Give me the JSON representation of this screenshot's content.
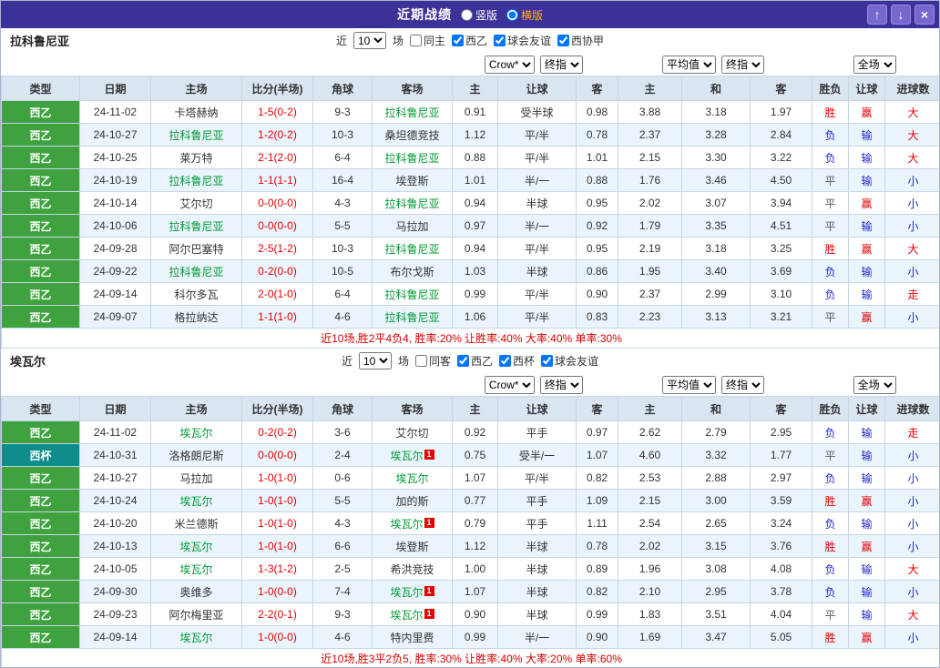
{
  "titlebar": {
    "title": "近期战绩",
    "layout_options": [
      {
        "label": "竖版",
        "selected": false
      },
      {
        "label": "横版",
        "selected": true
      }
    ],
    "buttons": {
      "up": "↑",
      "down": "↓",
      "close": "×"
    }
  },
  "colors": {
    "titlebar_bg": "#3c3099",
    "league": {
      "西乙": "#3fa23f",
      "西杯": "#0f8c8c"
    },
    "self_team": "#009933",
    "win_red": "#e60000",
    "lose_blue": "#2026d2"
  },
  "col_headers": [
    "类型",
    "日期",
    "主场",
    "比分(半场)",
    "角球",
    "客场",
    "主",
    "让球",
    "客",
    "主",
    "和",
    "客",
    "胜负",
    "让球",
    "进球数"
  ],
  "tables": [
    {
      "team": "拉科鲁尼亚",
      "near_prefix": "近",
      "near_count": "10",
      "near_suffix": "场",
      "filters": [
        {
          "label": "同主",
          "checked": false
        },
        {
          "label": "西乙",
          "checked": true
        },
        {
          "label": "球会友谊",
          "checked": true
        },
        {
          "label": "西协甲",
          "checked": true
        }
      ],
      "selects": {
        "bookmaker": "Crow*",
        "bookmaker_stage": "终指",
        "average": "平均值",
        "average_stage": "终指",
        "scope": "全场"
      },
      "rows": [
        {
          "league": "西乙",
          "date": "24-11-02",
          "home": "卡塔赫纳",
          "home_self": false,
          "score": "1-5(0-2)",
          "corner": "9-3",
          "away": "拉科鲁尼亚",
          "away_self": true,
          "odds": [
            "0.91",
            "受半球",
            "0.98"
          ],
          "avg": [
            "3.88",
            "3.18",
            "1.97"
          ],
          "results": [
            "胜",
            "赢",
            "大"
          ]
        },
        {
          "league": "西乙",
          "date": "24-10-27",
          "home": "拉科鲁尼亚",
          "home_self": true,
          "score": "1-2(0-2)",
          "corner": "10-3",
          "away": "桑坦德竞技",
          "away_self": false,
          "odds": [
            "1.12",
            "平/半",
            "0.78"
          ],
          "avg": [
            "2.37",
            "3.28",
            "2.84"
          ],
          "results": [
            "负",
            "输",
            "大"
          ]
        },
        {
          "league": "西乙",
          "date": "24-10-25",
          "home": "莱万特",
          "home_self": false,
          "score": "2-1(2-0)",
          "corner": "6-4",
          "away": "拉科鲁尼亚",
          "away_self": true,
          "odds": [
            "0.88",
            "平/半",
            "1.01"
          ],
          "avg": [
            "2.15",
            "3.30",
            "3.22"
          ],
          "results": [
            "负",
            "输",
            "大"
          ]
        },
        {
          "league": "西乙",
          "date": "24-10-19",
          "home": "拉科鲁尼亚",
          "home_self": true,
          "score": "1-1(1-1)",
          "corner": "16-4",
          "away": "埃登斯",
          "away_self": false,
          "odds": [
            "1.01",
            "半/一",
            "0.88"
          ],
          "avg": [
            "1.76",
            "3.46",
            "4.50"
          ],
          "results": [
            "平",
            "输",
            "小"
          ]
        },
        {
          "league": "西乙",
          "date": "24-10-14",
          "home": "艾尔切",
          "home_self": false,
          "score": "0-0(0-0)",
          "corner": "4-3",
          "away": "拉科鲁尼亚",
          "away_self": true,
          "odds": [
            "0.94",
            "半球",
            "0.95"
          ],
          "avg": [
            "2.02",
            "3.07",
            "3.94"
          ],
          "results": [
            "平",
            "赢",
            "小"
          ]
        },
        {
          "league": "西乙",
          "date": "24-10-06",
          "home": "拉科鲁尼亚",
          "home_self": true,
          "score": "0-0(0-0)",
          "corner": "5-5",
          "away": "马拉加",
          "away_self": false,
          "odds": [
            "0.97",
            "半/一",
            "0.92"
          ],
          "avg": [
            "1.79",
            "3.35",
            "4.51"
          ],
          "results": [
            "平",
            "输",
            "小"
          ]
        },
        {
          "league": "西乙",
          "date": "24-09-28",
          "home": "阿尔巴塞特",
          "home_self": false,
          "score": "2-5(1-2)",
          "corner": "10-3",
          "away": "拉科鲁尼亚",
          "away_self": true,
          "odds": [
            "0.94",
            "平/半",
            "0.95"
          ],
          "avg": [
            "2.19",
            "3.18",
            "3.25"
          ],
          "results": [
            "胜",
            "赢",
            "大"
          ]
        },
        {
          "league": "西乙",
          "date": "24-09-22",
          "home": "拉科鲁尼亚",
          "home_self": true,
          "score": "0-2(0-0)",
          "corner": "10-5",
          "away": "布尔戈斯",
          "away_self": false,
          "odds": [
            "1.03",
            "半球",
            "0.86"
          ],
          "avg": [
            "1.95",
            "3.40",
            "3.69"
          ],
          "results": [
            "负",
            "输",
            "小"
          ]
        },
        {
          "league": "西乙",
          "date": "24-09-14",
          "home": "科尔多瓦",
          "home_self": false,
          "score": "2-0(1-0)",
          "corner": "6-4",
          "away": "拉科鲁尼亚",
          "away_self": true,
          "odds": [
            "0.99",
            "平/半",
            "0.90"
          ],
          "avg": [
            "2.37",
            "2.99",
            "3.10"
          ],
          "results": [
            "负",
            "输",
            "走"
          ]
        },
        {
          "league": "西乙",
          "date": "24-09-07",
          "home": "格拉纳达",
          "home_self": false,
          "score": "1-1(1-0)",
          "corner": "4-6",
          "away": "拉科鲁尼亚",
          "away_self": true,
          "odds": [
            "1.06",
            "平/半",
            "0.83"
          ],
          "avg": [
            "2.23",
            "3.13",
            "3.21"
          ],
          "results": [
            "平",
            "赢",
            "小"
          ]
        }
      ],
      "summary": "近10场,胜2平4负4, 胜率:20% 让胜率:40% 大率:40% 单率:30%"
    },
    {
      "team": "埃瓦尔",
      "near_prefix": "近",
      "near_count": "10",
      "near_suffix": "场",
      "filters": [
        {
          "label": "同客",
          "checked": false
        },
        {
          "label": "西乙",
          "checked": true
        },
        {
          "label": "西杯",
          "checked": true
        },
        {
          "label": "球会友谊",
          "checked": true
        }
      ],
      "selects": {
        "bookmaker": "Crow*",
        "bookmaker_stage": "终指",
        "average": "平均值",
        "average_stage": "终指",
        "scope": "全场"
      },
      "rows": [
        {
          "league": "西乙",
          "date": "24-11-02",
          "home": "埃瓦尔",
          "home_self": true,
          "score": "0-2(0-2)",
          "corner": "3-6",
          "away": "艾尔切",
          "away_self": false,
          "odds": [
            "0.92",
            "平手",
            "0.97"
          ],
          "avg": [
            "2.62",
            "2.79",
            "2.95"
          ],
          "results": [
            "负",
            "输",
            "走"
          ]
        },
        {
          "league": "西杯",
          "date": "24-10-31",
          "home": "洛格朗尼斯",
          "home_self": false,
          "score": "0-0(0-0)",
          "corner": "2-4",
          "away": "埃瓦尔",
          "away_self": true,
          "away_badge": "1",
          "odds": [
            "0.75",
            "受半/一",
            "1.07"
          ],
          "avg": [
            "4.60",
            "3.32",
            "1.77"
          ],
          "results": [
            "平",
            "输",
            "小"
          ]
        },
        {
          "league": "西乙",
          "date": "24-10-27",
          "home": "马拉加",
          "home_self": false,
          "score": "1-0(1-0)",
          "corner": "0-6",
          "away": "埃瓦尔",
          "away_self": true,
          "odds": [
            "1.07",
            "平/半",
            "0.82"
          ],
          "avg": [
            "2.53",
            "2.88",
            "2.97"
          ],
          "results": [
            "负",
            "输",
            "小"
          ]
        },
        {
          "league": "西乙",
          "date": "24-10-24",
          "home": "埃瓦尔",
          "home_self": true,
          "score": "1-0(1-0)",
          "corner": "5-5",
          "away": "加的斯",
          "away_self": false,
          "odds": [
            "0.77",
            "平手",
            "1.09"
          ],
          "avg": [
            "2.15",
            "3.00",
            "3.59"
          ],
          "results": [
            "胜",
            "赢",
            "小"
          ]
        },
        {
          "league": "西乙",
          "date": "24-10-20",
          "home": "米兰德斯",
          "home_self": false,
          "score": "1-0(1-0)",
          "corner": "4-3",
          "away": "埃瓦尔",
          "away_self": true,
          "away_badge": "1",
          "odds": [
            "0.79",
            "平手",
            "1.11"
          ],
          "avg": [
            "2.54",
            "2.65",
            "3.24"
          ],
          "results": [
            "负",
            "输",
            "小"
          ]
        },
        {
          "league": "西乙",
          "date": "24-10-13",
          "home": "埃瓦尔",
          "home_self": true,
          "score": "1-0(1-0)",
          "corner": "6-6",
          "away": "埃登斯",
          "away_self": false,
          "odds": [
            "1.12",
            "半球",
            "0.78"
          ],
          "avg": [
            "2.02",
            "3.15",
            "3.76"
          ],
          "results": [
            "胜",
            "赢",
            "小"
          ]
        },
        {
          "league": "西乙",
          "date": "24-10-05",
          "home": "埃瓦尔",
          "home_self": true,
          "score": "1-3(1-2)",
          "corner": "2-5",
          "away": "希洪竞技",
          "away_self": false,
          "odds": [
            "1.00",
            "半球",
            "0.89"
          ],
          "avg": [
            "1.96",
            "3.08",
            "4.08"
          ],
          "results": [
            "负",
            "输",
            "大"
          ]
        },
        {
          "league": "西乙",
          "date": "24-09-30",
          "home": "奥维多",
          "home_self": false,
          "score": "1-0(0-0)",
          "corner": "7-4",
          "away": "埃瓦尔",
          "away_self": true,
          "away_badge": "1",
          "odds": [
            "1.07",
            "半球",
            "0.82"
          ],
          "avg": [
            "2.10",
            "2.95",
            "3.78"
          ],
          "results": [
            "负",
            "输",
            "小"
          ]
        },
        {
          "league": "西乙",
          "date": "24-09-23",
          "home": "阿尔梅里亚",
          "home_self": false,
          "score": "2-2(0-1)",
          "corner": "9-3",
          "away": "埃瓦尔",
          "away_self": true,
          "away_badge": "1",
          "odds": [
            "0.90",
            "半球",
            "0.99"
          ],
          "avg": [
            "1.83",
            "3.51",
            "4.04"
          ],
          "results": [
            "平",
            "输",
            "大"
          ]
        },
        {
          "league": "西乙",
          "date": "24-09-14",
          "home": "埃瓦尔",
          "home_self": true,
          "score": "1-0(0-0)",
          "corner": "4-6",
          "away": "特内里费",
          "away_self": false,
          "odds": [
            "0.99",
            "半/一",
            "0.90"
          ],
          "avg": [
            "1.69",
            "3.47",
            "5.05"
          ],
          "results": [
            "胜",
            "赢",
            "小"
          ]
        }
      ],
      "summary": "近10场,胜3平2负5, 胜率:30% 让胜率:40% 大率:20% 单率:60%"
    }
  ]
}
